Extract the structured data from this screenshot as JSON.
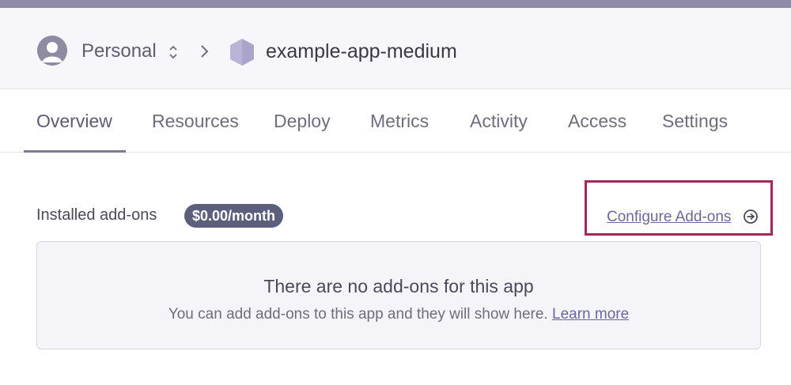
{
  "colors": {
    "accent": "#6a67a0",
    "badge_bg": "#5c5f7b",
    "highlight": "#a3275a",
    "header_bg": "#f7f7fb"
  },
  "header": {
    "team": "Personal",
    "app_name": "example-app-medium",
    "icons": [
      "avatar-icon",
      "switch-team-icon",
      "chevron-right-icon",
      "app-hexagon-icon"
    ]
  },
  "tabs": [
    {
      "label": "Overview",
      "active": true
    },
    {
      "label": "Resources",
      "active": false
    },
    {
      "label": "Deploy",
      "active": false
    },
    {
      "label": "Metrics",
      "active": false
    },
    {
      "label": "Activity",
      "active": false
    },
    {
      "label": "Access",
      "active": false
    },
    {
      "label": "Settings",
      "active": false
    }
  ],
  "addons": {
    "title": "Installed add-ons",
    "cost_badge": "$0.00/month",
    "configure_label": "Configure Add-ons",
    "empty_title": "There are no add-ons for this app",
    "empty_desc": "You can add add-ons to this app and they will show here.",
    "learn_more": "Learn more"
  }
}
